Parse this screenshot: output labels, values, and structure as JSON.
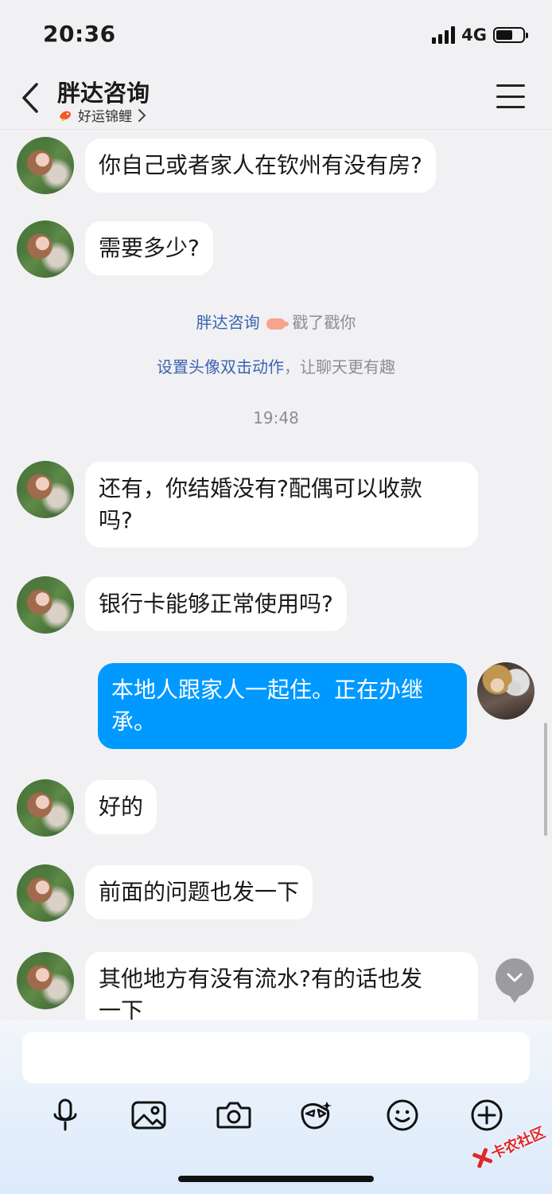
{
  "status_bar": {
    "time": "20:36",
    "network": "4G",
    "battery_level": 0.62
  },
  "header": {
    "title": "胖达咨询",
    "subtitle": "好运锦鲤"
  },
  "messages": [
    {
      "text": "你自己或者家人在钦州有没有房?"
    },
    {
      "text": "需要多少?"
    },
    {
      "sender": "胖达咨询",
      "action": "戳了戳你"
    },
    {
      "link": "设置头像双击动作",
      "rest": "，让聊天更有趣"
    },
    {
      "time": "19:48"
    },
    {
      "line1": "还有，你结婚没有?配偶可以收款",
      "line2": "吗?"
    },
    {
      "text": "银行卡能够正常使用吗?"
    },
    {
      "line1": "本地人跟家人一起住。正在办继",
      "line2": "承。"
    },
    {
      "text": "好的"
    },
    {
      "text": "前面的问题也发一下"
    },
    {
      "line1": "其他地方有没有流水?有的话也发",
      "line2": "一下"
    }
  ],
  "input": {
    "value": ""
  },
  "icons": {
    "back": "chevron-left-icon",
    "menu": "hamburger-menu-icon",
    "koi": "koi-fish-icon",
    "scroll_down": "chevron-down-icon",
    "voice": "microphone-icon",
    "image": "image-icon",
    "camera": "camera-icon",
    "sticker": "sticker-icon",
    "emoji": "emoji-icon",
    "more": "plus-circle-icon"
  },
  "watermark": {
    "text": "卡农社区"
  },
  "colors": {
    "outgoing_bubble": "#0099ff",
    "incoming_bubble": "#ffffff",
    "link": "#3b63b1",
    "background": "#f1f1f3"
  }
}
